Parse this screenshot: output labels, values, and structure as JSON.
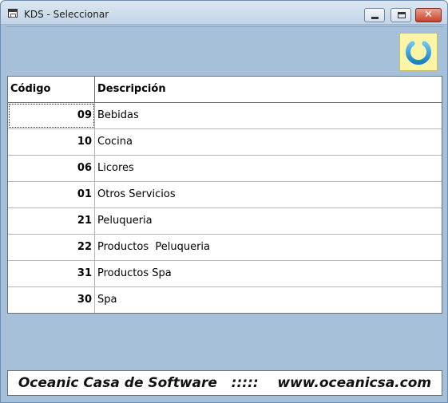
{
  "window": {
    "title": "KDS - Seleccionar",
    "close_glyph": "✕"
  },
  "toolbar": {
    "power_icon": "power-icon",
    "power_color": "#2a9ad8",
    "power_bg": "#fbf5a8"
  },
  "grid": {
    "headers": {
      "code": "Código",
      "description": "Descripción"
    },
    "rows": [
      {
        "code": "09",
        "description": "Bebidas"
      },
      {
        "code": "10",
        "description": "Cocina"
      },
      {
        "code": "06",
        "description": "Licores"
      },
      {
        "code": "01",
        "description": "Otros Servicios"
      },
      {
        "code": "21",
        "description": "Peluqueria"
      },
      {
        "code": "22",
        "description": "Productos  Peluqueria"
      },
      {
        "code": "31",
        "description": "Productos Spa"
      },
      {
        "code": "30",
        "description": "Spa"
      }
    ],
    "selected_index": 0
  },
  "footer": {
    "text": "Oceanic Casa de Software   :::::    www.oceanicsa.com"
  },
  "colors": {
    "panel": "#a6c0d9",
    "grid_bg": "#ffffff"
  }
}
